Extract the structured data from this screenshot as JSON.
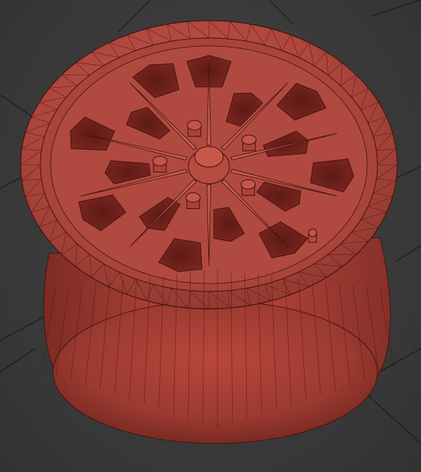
{
  "viewport": {
    "background": "#3d3d3d",
    "grid_color": "#1a1a1a",
    "shading": "wireframe-on-shaded"
  },
  "model": {
    "name": "wheel-rim",
    "base_color": "#b0453c",
    "shadow_color": "#6e1f1a",
    "highlight_color": "#cf6a5e",
    "wire_color": "#4a1410",
    "windows": 15,
    "lug_nuts": 5,
    "spokes": 10
  }
}
